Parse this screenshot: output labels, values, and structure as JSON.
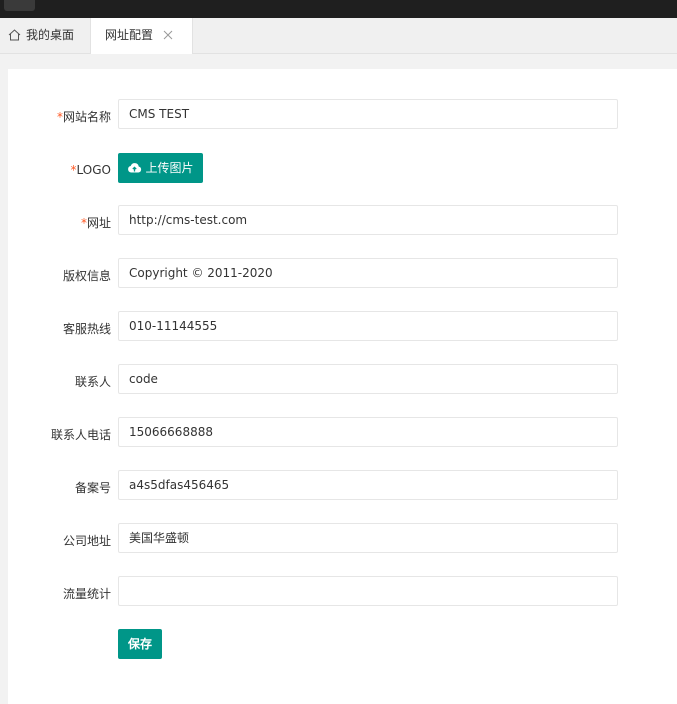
{
  "tabs": {
    "home_label": "我的桌面",
    "active_label": "网址配置"
  },
  "form": {
    "site_name": {
      "required_mark": "*",
      "label": "网站名称",
      "value": "CMS TEST"
    },
    "logo": {
      "required_mark": "*",
      "label": "LOGO",
      "button": "上传图片"
    },
    "url": {
      "required_mark": "*",
      "label": "网址",
      "value": "http://cms-test.com"
    },
    "copyright": {
      "label": "版权信息",
      "value": "Copyright © 2011-2020"
    },
    "hotline": {
      "label": "客服热线",
      "value": "010-11144555"
    },
    "contact": {
      "label": "联系人",
      "value": "code"
    },
    "contact_phone": {
      "label": "联系人电话",
      "value": "15066668888"
    },
    "icp": {
      "label": "备案号",
      "value": "a4s5dfas456465"
    },
    "address": {
      "label": "公司地址",
      "value": "美国华盛顿"
    },
    "analytics": {
      "label": "流量统计",
      "value": ""
    },
    "save_button": "保存"
  },
  "colors": {
    "accent": "#009688",
    "required": "#ff5722",
    "topbar": "#1f1f1f"
  },
  "icons": {
    "home": "home-icon",
    "close": "close-icon",
    "upload": "cloud-upload-icon"
  }
}
